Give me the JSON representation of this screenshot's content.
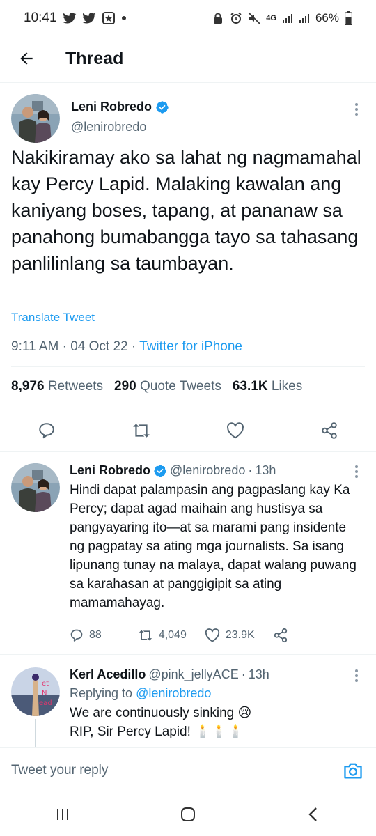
{
  "status_bar": {
    "time": "10:41",
    "battery": "66%",
    "network": "4G"
  },
  "header": {
    "title": "Thread"
  },
  "main_tweet": {
    "author_name": "Leni Robredo",
    "author_handle": "@lenirobredo",
    "text": "Nakikiramay ako sa lahat ng nagmamahal kay Percy Lapid. Malaking kawalan ang kaniyang boses, tapang, at pananaw sa panahong bumabangga tayo sa tahasang panlilinlang sa taumbayan.",
    "translate": "Translate Tweet",
    "time": "9:11 AM",
    "date": "04 Oct 22",
    "source": "Twitter for iPhone",
    "retweets_count": "8,976",
    "retweets_label": "Retweets",
    "quotes_count": "290",
    "quotes_label": "Quote Tweets",
    "likes_count": "63.1K",
    "likes_label": "Likes"
  },
  "replies": [
    {
      "author_name": "Leni Robredo",
      "author_handle": "@lenirobredo",
      "age": "13h",
      "text": "Hindi dapat palampasin ang pagpaslang kay Ka Percy; dapat agad maihain ang hustisya sa pangyayaring ito—at sa marami pang insidente ng pagpatay sa ating mga journalists. Sa isang lipunang tunay na malaya, dapat walang puwang sa karahasan at panggigipit sa ating mamamahayag.",
      "reply_count": "88",
      "retweet_count": "4,049",
      "like_count": "23.9K"
    },
    {
      "author_name": "Kerl Acedillo",
      "author_handle": "@pink_jellyACE",
      "age": "13h",
      "replying_prefix": "Replying to",
      "replying_to": "@lenirobredo",
      "line1": "We are continuously sinking",
      "line1_emoji": "😢",
      "line2": "RIP, Sir Percy Lapid!",
      "line2_emoji": "🕯️🕯️🕯️"
    }
  ],
  "compose": {
    "placeholder": "Tweet your reply"
  },
  "colors": {
    "accent": "#1d9bf0",
    "text_primary": "#0f1419",
    "text_secondary": "#536471",
    "divider": "#eff3f4"
  }
}
